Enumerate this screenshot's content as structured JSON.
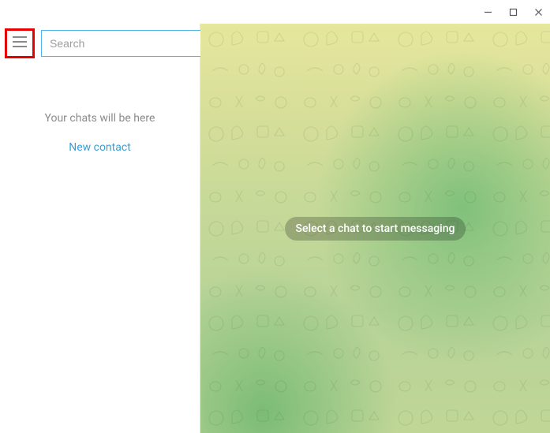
{
  "window_controls": {
    "minimize_glyph": "—",
    "maximize_glyph": "☐",
    "close_glyph": "✕"
  },
  "sidebar": {
    "search_placeholder": "Search",
    "empty_text": "Your chats will be here",
    "new_contact_label": "New contact"
  },
  "main": {
    "placeholder_text": "Select a chat to start messaging"
  },
  "icons": {
    "menu": "hamburger-icon"
  },
  "colors": {
    "highlight_red": "#e60000",
    "link_blue": "#3a9fd6",
    "search_border": "#4fb4e8"
  }
}
